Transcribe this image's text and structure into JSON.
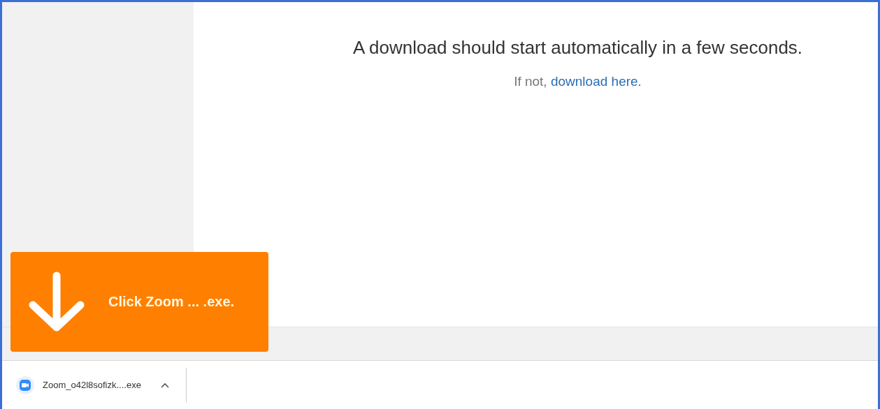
{
  "page": {
    "heading": "A download should start automatically in a few seconds.",
    "fallback": {
      "text": "If not,",
      "link": "download here."
    }
  },
  "callout": {
    "text": "Click Zoom ... .exe."
  },
  "download_bar": {
    "items": [
      {
        "filename": "Zoom_o42l8sofizk....exe",
        "expanded": false
      }
    ]
  }
}
